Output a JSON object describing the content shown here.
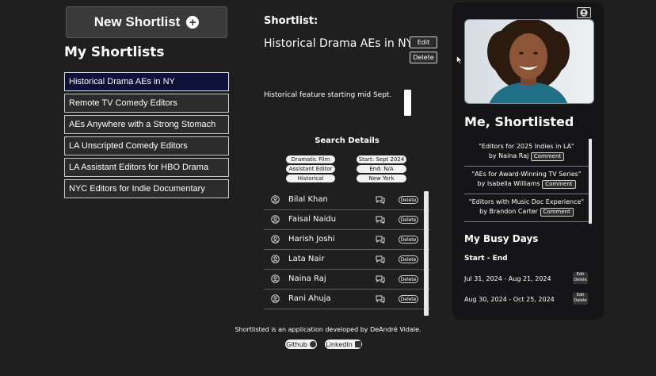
{
  "left": {
    "new_button": "New Shortlist",
    "title": "My Shortlists",
    "shortlists": [
      "Historical Drama AEs in NY",
      "Remote TV Comedy Editors",
      "AEs Anywhere with a Strong Stomach",
      "LA Unscripted Comedy Editors",
      "LA Assistant Editors for HBO Drama",
      "NYC Editors for Indie Documentary"
    ]
  },
  "middle": {
    "label": "Shortlist:",
    "title": "Historical Drama AEs in NY",
    "edit": "Edit",
    "delete": "Delete",
    "notes": "Historical feature starting mid Sept.",
    "search_title": "Search Details",
    "tags": [
      "Dramatic Film",
      "Start: Sept 2024",
      "Assistant Editor",
      "End: N/A",
      "Historical",
      "New York"
    ],
    "results": [
      "Bilal Khan",
      "Faisal Naidu",
      "Harish Joshi",
      "Lata Nair",
      "Naina Raj",
      "Rani Ahuja"
    ],
    "row_delete": "Delete"
  },
  "right": {
    "title": "Me, Shortlisted",
    "entries": [
      {
        "title": "\"Editors for 2025 Indies in LA\"",
        "by": "by Naina Raj"
      },
      {
        "title": "\"AEs for Award-Winning TV Series\"",
        "by": "by Isabella Williams"
      },
      {
        "title": "\"Editors with Music Doc Experience\"",
        "by": "by Brandon Carter"
      }
    ],
    "comment": "Comment",
    "busy_title": "My Busy Days",
    "start_end": "Start - End",
    "dates": [
      "Jul 31, 2024 - Aug 21, 2024",
      "Aug 30, 2024 - Oct 25, 2024"
    ],
    "mini_edit": "Edit",
    "mini_delete": "Delete"
  },
  "footer": {
    "text": "Shortlisted is an application developed by DeAndré Vidale.",
    "github": "Github",
    "linkedin": "LinkedIn"
  },
  "icons": [
    "plus-icon",
    "user-icon",
    "chat-icon",
    "profile-icon",
    "github-icon",
    "linkedin-icon",
    "cursor-icon"
  ]
}
